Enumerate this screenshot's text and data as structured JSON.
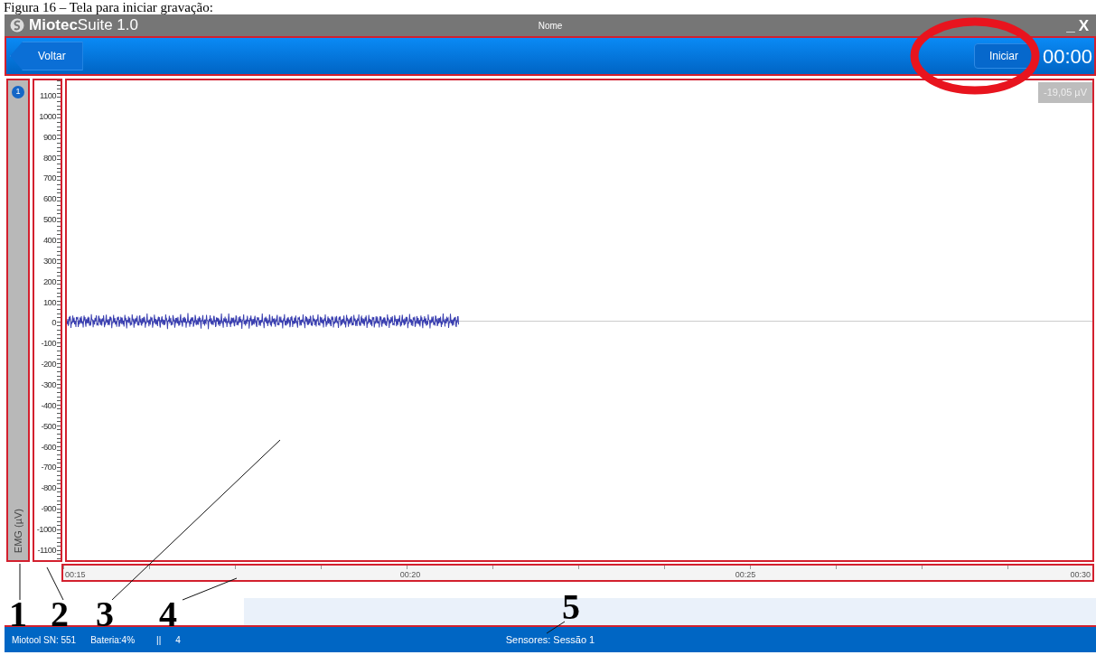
{
  "caption": "Figura 16 – Tela para iniciar gravação:",
  "window": {
    "title": "**Miotec**Suite 1.0",
    "document": "Nome",
    "minimize": "_",
    "close": "X"
  },
  "toolbar": {
    "back": "Voltar",
    "start": "Iniciar",
    "timer": "00:00",
    "start_highlighted": true
  },
  "channels": [
    {
      "number": "1",
      "label": "EMG (µV)"
    }
  ],
  "y_axis": {
    "ticks": [
      "1100",
      "1000",
      "900",
      "800",
      "700",
      "600",
      "500",
      "400",
      "300",
      "200",
      "100",
      "0",
      "-100",
      "-200",
      "-300",
      "-400",
      "-500",
      "-600",
      "-700",
      "-800",
      "-900",
      "-1000",
      "-1100"
    ]
  },
  "plot": {
    "reading": "-19,05 µV"
  },
  "time_axis": {
    "ticks": [
      "00:15",
      "00:20",
      "00:25",
      "00:30"
    ]
  },
  "status_bar": {
    "device": "Miotool SN: 551",
    "battery": "Bateria:4%",
    "separator": "||",
    "count": "4",
    "sensors": "Sensores: Sessão 1"
  },
  "callouts": [
    "1",
    "2",
    "3",
    "4",
    "5"
  ]
}
